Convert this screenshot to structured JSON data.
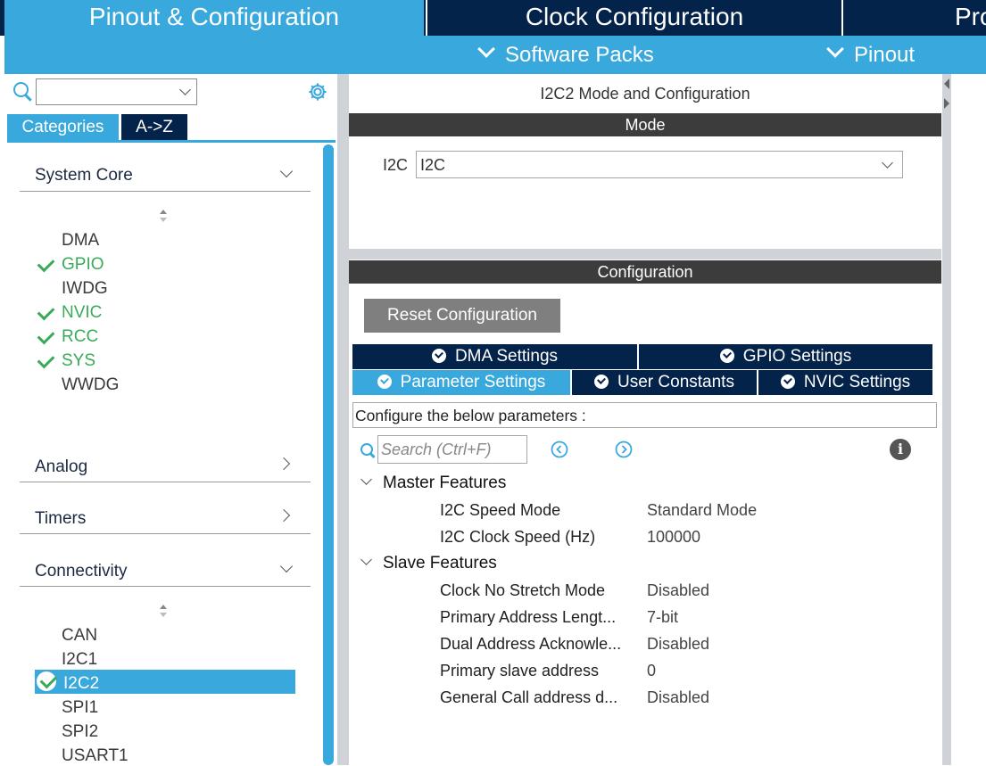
{
  "top_tabs": {
    "pinout": "Pinout & Configuration",
    "clock": "Clock Configuration",
    "project": "Pro"
  },
  "sub_menu": {
    "software_packs": "Software Packs",
    "pinout": "Pinout"
  },
  "left_panel": {
    "search_value": "",
    "tabs": {
      "categories": "Categories",
      "az": "A->Z"
    },
    "groups": {
      "system_core": {
        "label": "System Core",
        "items": [
          "DMA",
          "GPIO",
          "IWDG",
          "NVIC",
          "RCC",
          "SYS",
          "WWDG"
        ]
      },
      "analog": {
        "label": "Analog"
      },
      "timers": {
        "label": "Timers"
      },
      "connectivity": {
        "label": "Connectivity",
        "items": [
          "CAN",
          "I2C1",
          "I2C2",
          "SPI1",
          "SPI2",
          "USART1"
        ]
      }
    }
  },
  "main": {
    "title": "I2C2 Mode and Configuration",
    "mode_header": "Mode",
    "mode_label": "I2C",
    "mode_value": "I2C",
    "config_header": "Configuration",
    "reset_button": "Reset Configuration",
    "tabs": {
      "dma": "DMA Settings",
      "gpio": "GPIO Settings",
      "parameter": "Parameter Settings",
      "user_constants": "User Constants",
      "nvic": "NVIC Settings"
    },
    "configure_hint": "Configure the below parameters :",
    "search_placeholder": "Search (Ctrl+F)",
    "sections": {
      "master": {
        "label": "Master Features",
        "params": [
          {
            "name": "I2C Speed Mode",
            "value": "Standard Mode"
          },
          {
            "name": "I2C Clock Speed (Hz)",
            "value": "100000"
          }
        ]
      },
      "slave": {
        "label": "Slave Features",
        "params": [
          {
            "name": "Clock No Stretch Mode",
            "value": "Disabled"
          },
          {
            "name": "Primary Address Lengt...",
            "value": "7-bit"
          },
          {
            "name": "Dual Address Acknowle...",
            "value": "Disabled"
          },
          {
            "name": "Primary slave address",
            "value": "0"
          },
          {
            "name": "General Call address d...",
            "value": "Disabled"
          }
        ]
      }
    }
  },
  "colors": {
    "accent_blue": "#39a8dc",
    "navy": "#03234b",
    "ok_green": "#3aaa5a",
    "header_dark": "#3c3c3c"
  }
}
